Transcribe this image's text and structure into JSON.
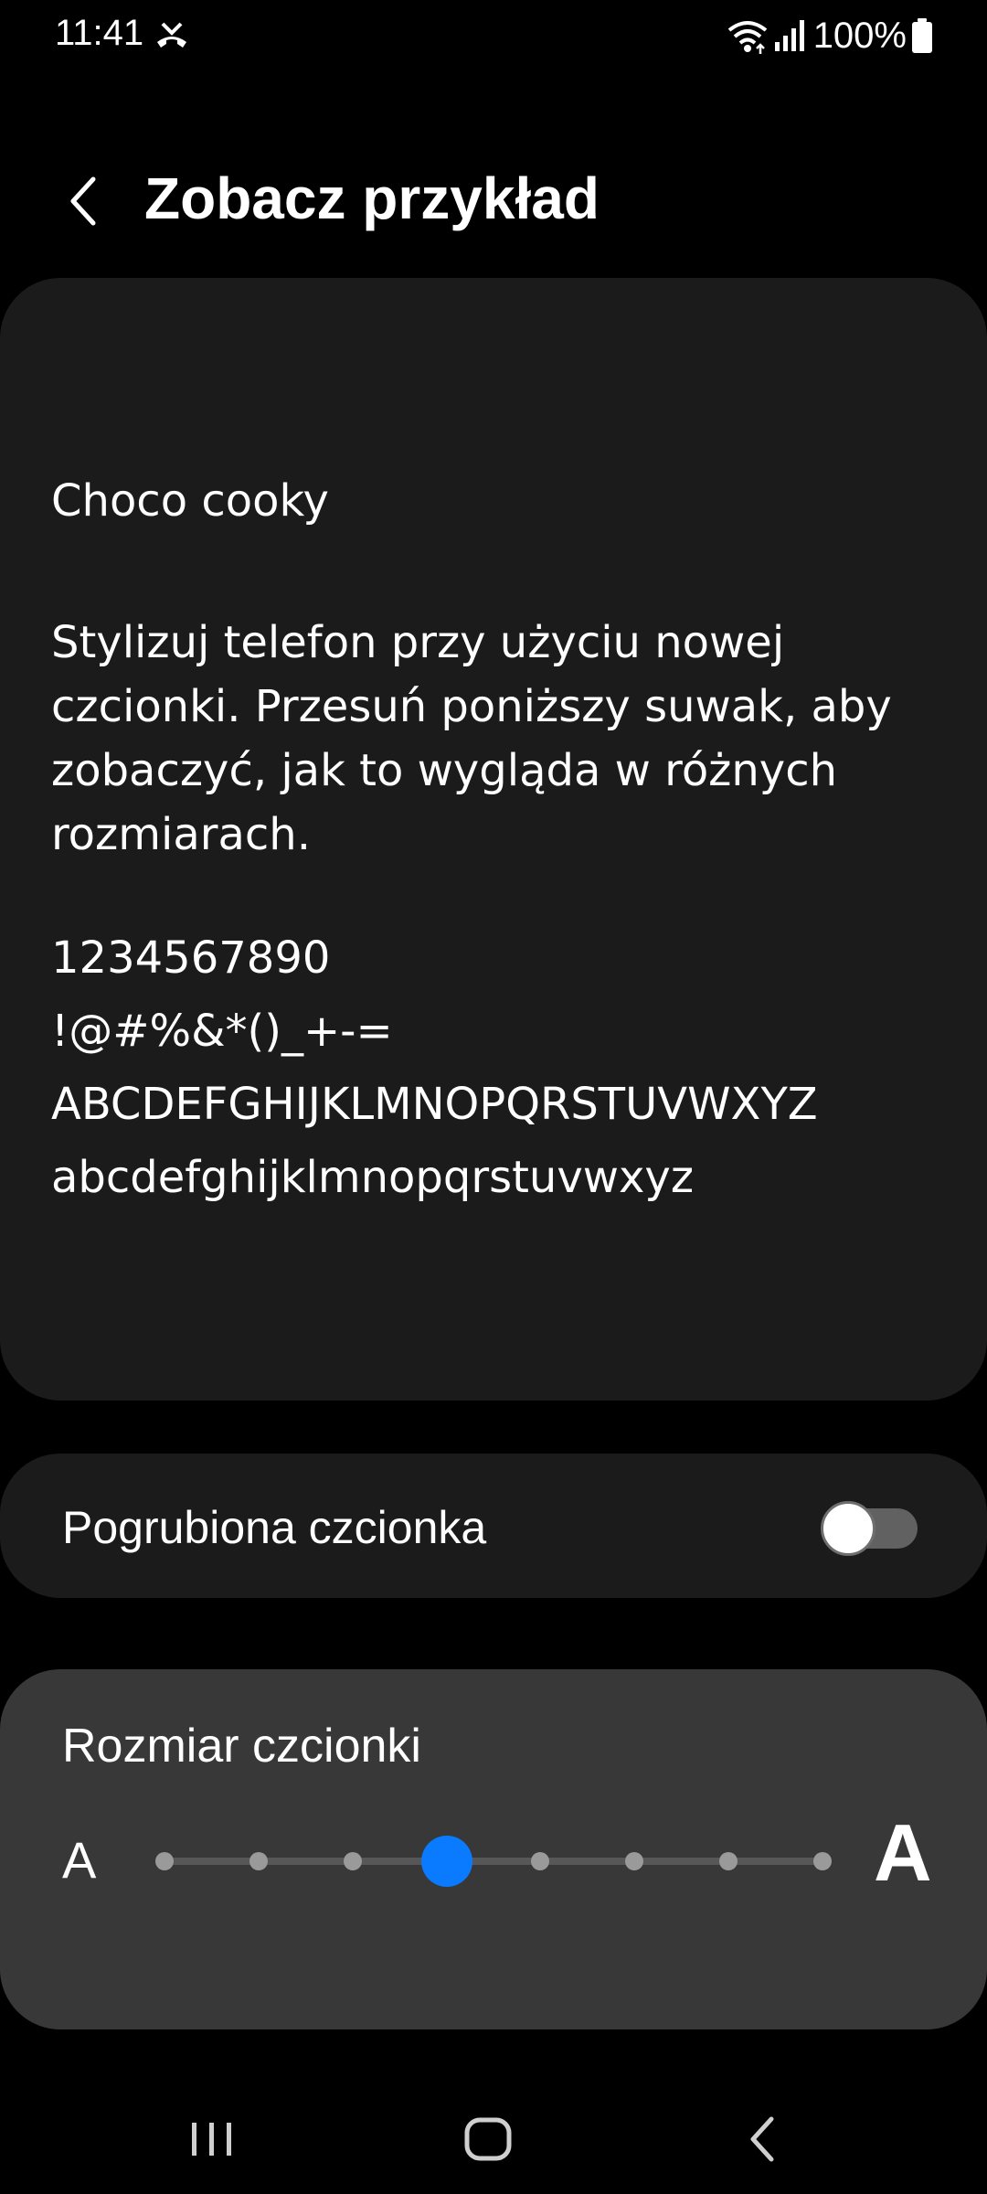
{
  "status_bar": {
    "time": "11:41",
    "battery": "100%",
    "icons": [
      "missed-call-icon",
      "wifi-icon",
      "signal-icon",
      "battery-icon"
    ]
  },
  "header": {
    "title": "Zobacz przykład",
    "back_icon": "chevron-left-icon"
  },
  "preview": {
    "font_name": "Choco cooky",
    "description": "Stylizuj telefon przy użyciu nowej czcionki. Przesuń poniższy suwak, aby zobaczyć, jak to wygląda w różnych rozmiarach.",
    "digits": "1234567890",
    "symbols": "!@#%&*()_+-=",
    "uppercase": "ABCDEFGHIJKLMNOPQRSTUVWXYZ",
    "lowercase": "abcdefghijklmnopqrstuvwxyz"
  },
  "bold_font": {
    "label": "Pogrubiona czcionka",
    "enabled": false
  },
  "font_size": {
    "title": "Rozmiar czcionki",
    "small_label": "A",
    "large_label": "A",
    "steps": 8,
    "selected_index": 3
  },
  "colors": {
    "background": "#000000",
    "card": "#1b1b1b",
    "size_card": "#383838",
    "accent": "#0a7bff",
    "toggle_track_off": "#616161"
  },
  "nav_bar": {
    "icons": [
      "recents-icon",
      "home-icon",
      "back-icon"
    ]
  }
}
